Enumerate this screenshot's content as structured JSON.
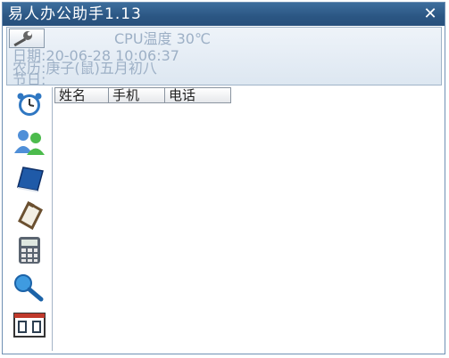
{
  "window": {
    "title": "易人办公助手1.13"
  },
  "info": {
    "cpu_temp": "CPU温度 30℃",
    "date_line": "日期:20-06-28 10:06:37",
    "lunar_line": "农历:庚子(鼠)五月初八",
    "festival_line": "节日:"
  },
  "table": {
    "headers": [
      "姓名",
      "手机",
      "电话"
    ]
  },
  "sidebar": {
    "items": [
      "alarm-clock-icon",
      "contacts-icon",
      "notebook-icon",
      "clipboard-icon",
      "calculator-icon",
      "search-icon",
      "calendar-icon"
    ]
  },
  "colors": {
    "titlebar": "#2b5683",
    "info_text": "#9db0c6",
    "border": "#6f90b4"
  }
}
